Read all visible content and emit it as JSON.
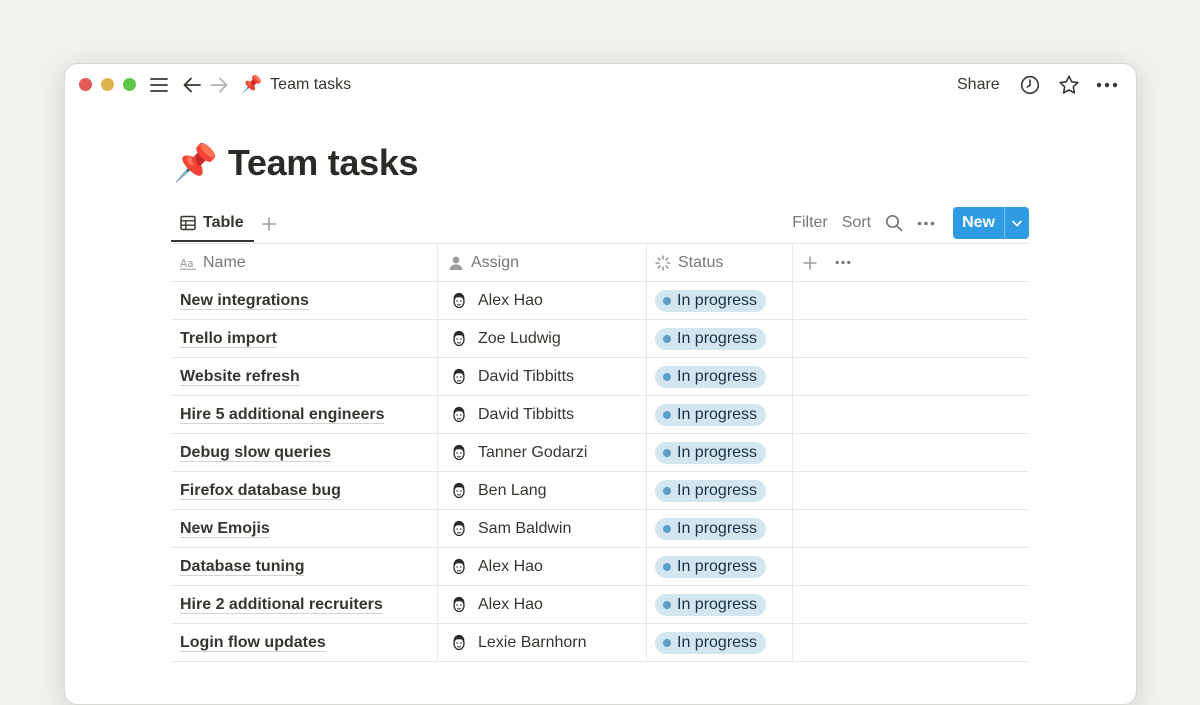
{
  "window": {
    "breadcrumb_emoji": "📌",
    "breadcrumb_title": "Team tasks",
    "share_label": "Share"
  },
  "page": {
    "emoji": "📌",
    "title": "Team tasks"
  },
  "view": {
    "tab_label": "Table",
    "filter_label": "Filter",
    "sort_label": "Sort",
    "new_label": "New"
  },
  "columns": {
    "name": "Name",
    "assign": "Assign",
    "status": "Status"
  },
  "rows": [
    {
      "name": "New integrations",
      "assignee": "Alex Hao",
      "status": "In progress"
    },
    {
      "name": "Trello import",
      "assignee": "Zoe Ludwig",
      "status": "In progress"
    },
    {
      "name": "Website refresh",
      "assignee": "David Tibbitts",
      "status": "In progress"
    },
    {
      "name": "Hire 5 additional engineers",
      "assignee": "David Tibbitts",
      "status": "In progress"
    },
    {
      "name": "Debug slow queries",
      "assignee": "Tanner Godarzi",
      "status": "In progress"
    },
    {
      "name": "Firefox database bug",
      "assignee": "Ben Lang",
      "status": "In progress"
    },
    {
      "name": "New Emojis",
      "assignee": "Sam Baldwin",
      "status": "In progress"
    },
    {
      "name": "Database tuning",
      "assignee": "Alex Hao",
      "status": "In progress"
    },
    {
      "name": "Hire 2 additional recruiters",
      "assignee": "Alex Hao",
      "status": "In progress"
    },
    {
      "name": "Login flow updates",
      "assignee": "Lexie Barnhorn",
      "status": "In progress"
    }
  ],
  "colors": {
    "accent": "#2f9be3",
    "status_bg": "#d3e5ef",
    "status_dot": "#5e9fc7"
  },
  "icons": [
    "menu-icon",
    "back-arrow-icon",
    "forward-arrow-icon",
    "pushpin-icon",
    "clock-icon",
    "star-icon",
    "more-icon",
    "table-icon",
    "plus-icon",
    "search-icon",
    "chevron-down-icon",
    "text-type-icon",
    "person-icon",
    "status-icon",
    "avatar-icon"
  ]
}
